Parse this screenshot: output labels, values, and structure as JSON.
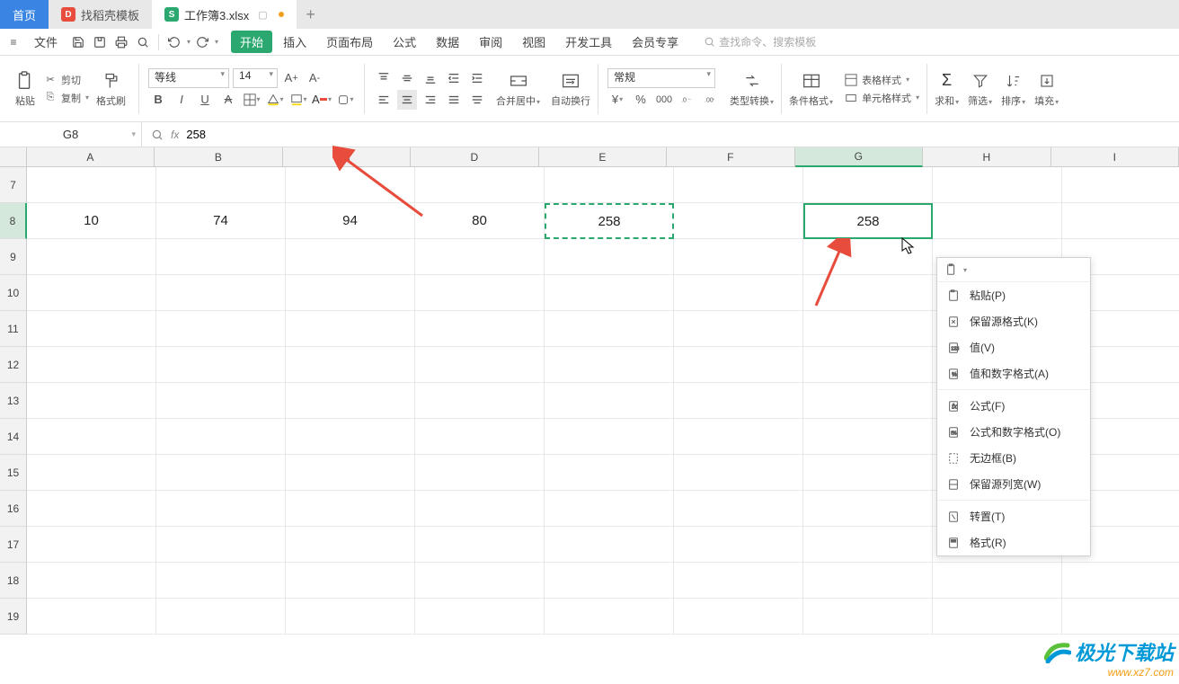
{
  "tabs": {
    "home": "首页",
    "docker": "找稻壳模板",
    "active": "工作簿3.xlsx"
  },
  "top_menu": {
    "file": "文件",
    "start": "开始",
    "insert": "插入",
    "layout": "页面布局",
    "formula": "公式",
    "data": "数据",
    "review": "审阅",
    "view": "视图",
    "dev": "开发工具",
    "vip": "会员专享",
    "search_placeholder": "查找命令、搜索模板"
  },
  "ribbon": {
    "paste": "粘贴",
    "cut": "剪切",
    "copy": "复制",
    "fmt_paint": "格式刷",
    "font_name": "等线",
    "font_size": "14",
    "merge": "合并居中",
    "wrap": "自动换行",
    "num_fmt": "常规",
    "type_conv": "类型转换",
    "cond_fmt": "条件格式",
    "table_style": "表格样式",
    "cell_style": "单元格样式",
    "sum": "求和",
    "filter": "筛选",
    "sort": "排序",
    "fill": "填充"
  },
  "formula_bar": {
    "cell_ref": "G8",
    "formula": "258"
  },
  "columns": [
    "A",
    "B",
    "C",
    "D",
    "E",
    "F",
    "G",
    "H",
    "I"
  ],
  "rows_visible": [
    "7",
    "8",
    "9",
    "10",
    "11",
    "12",
    "13",
    "14",
    "15",
    "16",
    "17",
    "18",
    "19"
  ],
  "data_row": {
    "A": "10",
    "B": "74",
    "C": "94",
    "D": "80",
    "E": "258",
    "G": "258"
  },
  "copy_cell": "E8",
  "selected_cell": "G8",
  "context_menu": {
    "head": "粘贴选项",
    "items": [
      {
        "label": "粘贴(P)"
      },
      {
        "label": "保留源格式(K)"
      },
      {
        "label": "值(V)"
      },
      {
        "label": "值和数字格式(A)"
      },
      {
        "sep": true
      },
      {
        "label": "公式(F)"
      },
      {
        "label": "公式和数字格式(O)"
      },
      {
        "label": "无边框(B)"
      },
      {
        "label": "保留源列宽(W)"
      },
      {
        "sep": true
      },
      {
        "label": "转置(T)"
      },
      {
        "label": "格式(R)"
      }
    ]
  },
  "watermark": {
    "brand": "极光下载站",
    "url": "www.xz7.com"
  }
}
